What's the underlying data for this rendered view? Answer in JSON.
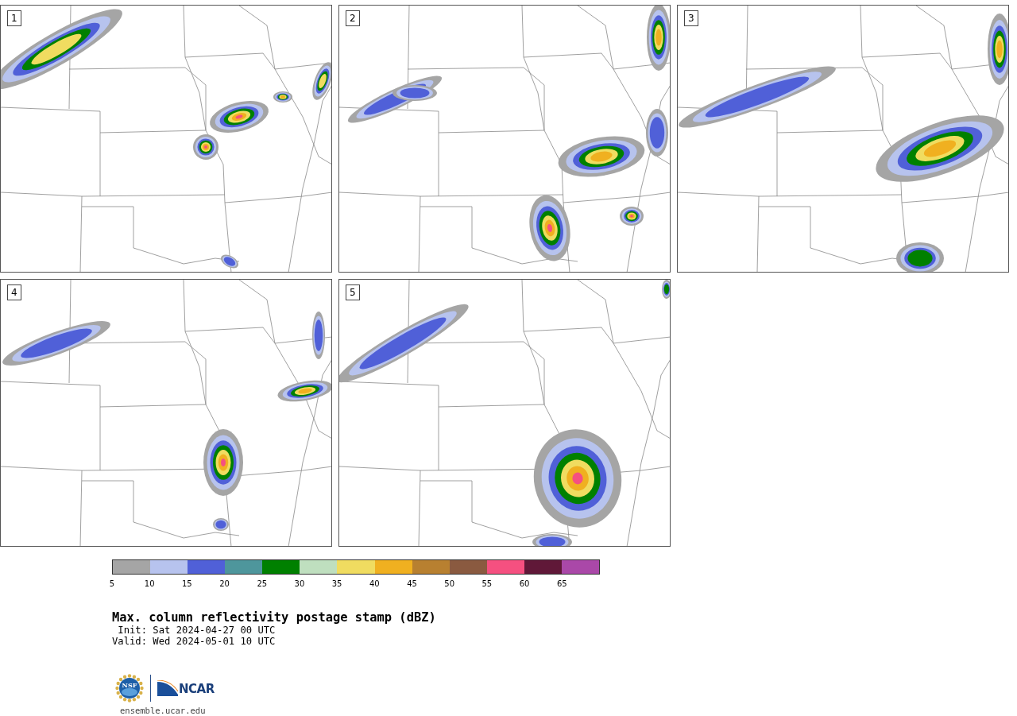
{
  "panels": [
    {
      "number": "1"
    },
    {
      "number": "2"
    },
    {
      "number": "3"
    },
    {
      "number": "4"
    },
    {
      "number": "5"
    }
  ],
  "colorbar": {
    "swatches": [
      {
        "color": "#a5a5a5"
      },
      {
        "color": "#b7c3ee"
      },
      {
        "color": "#5060d8"
      },
      {
        "color": "#4e969c"
      },
      {
        "color": "#008000"
      },
      {
        "color": "#bfdfbf"
      },
      {
        "color": "#f0dc60"
      },
      {
        "color": "#f0b020"
      },
      {
        "color": "#b88030"
      },
      {
        "color": "#8a5a40"
      },
      {
        "color": "#f55080"
      },
      {
        "color": "#601838"
      },
      {
        "color": "#aa48a8"
      }
    ],
    "ticks": [
      "5",
      "10",
      "15",
      "20",
      "25",
      "30",
      "35",
      "40",
      "45",
      "50",
      "55",
      "60",
      "65"
    ]
  },
  "title": "Max. column reflectivity postage stamp (dBZ)",
  "init": " Init: Sat 2024-04-27 00 UTC",
  "valid": "Valid: Wed 2024-05-01 10 UTC",
  "logo": {
    "nsf": "NSF",
    "ncar": "NCAR"
  },
  "url": "ensemble.ucar.edu"
}
